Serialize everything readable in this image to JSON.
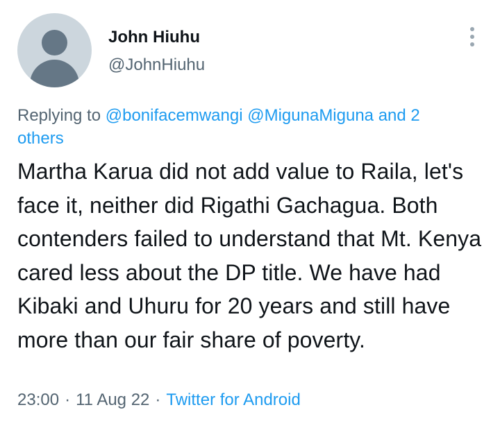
{
  "author": {
    "name": "John Hiuhu",
    "handle": "@JohnHiuhu"
  },
  "reply": {
    "prefix": "Replying to",
    "mentions": [
      "@bonifacemwangi",
      "@MigunaMiguna"
    ],
    "others": "and 2 others"
  },
  "tweet": {
    "text": "Martha Karua did not add value to Raila, let's face it, neither did Rigathi Gachagua. Both contenders failed to understand that Mt. Kenya cared less about the DP title. We have had Kibaki and Uhuru for 20 years and still have more than our fair share of poverty."
  },
  "meta": {
    "time": "23:00",
    "date": "11 Aug 22",
    "separator": "·",
    "source": "Twitter for Android"
  },
  "icons": {
    "more": "more-vertical-icon",
    "avatar": "default-avatar-icon"
  },
  "colors": {
    "link": "#1d9bf0",
    "secondary_text": "#536471",
    "primary_text": "#0f1419"
  }
}
